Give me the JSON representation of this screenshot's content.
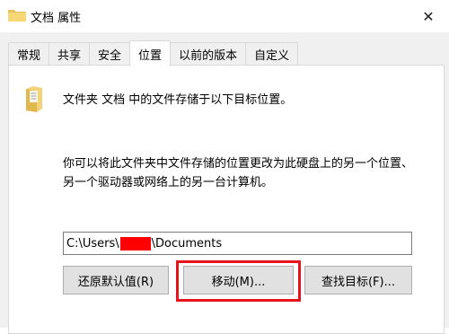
{
  "window": {
    "title": "文档 属性",
    "close_glyph": "✕"
  },
  "tabs": [
    {
      "label": "常规",
      "active": false
    },
    {
      "label": "共享",
      "active": false
    },
    {
      "label": "安全",
      "active": false
    },
    {
      "label": "位置",
      "active": true
    },
    {
      "label": "以前的版本",
      "active": false
    },
    {
      "label": "自定义",
      "active": false
    }
  ],
  "location": {
    "info": "文件夹 文档 中的文件存储于以下目标位置。",
    "description": "你可以将此文件夹中文件存储的位置更改为此硬盘上的另一个位置、另一个驱动器或网络上的另一台计算机。",
    "path_prefix": "C:\\Users\\",
    "path_suffix": "\\Documents"
  },
  "buttons": {
    "restore": "还原默认值(R)",
    "move": "移动(M)...",
    "find": "查找目标(F)..."
  },
  "colors": {
    "highlight": "#e8141d",
    "redaction": "#ff0000",
    "folder": "#e8c25a"
  }
}
